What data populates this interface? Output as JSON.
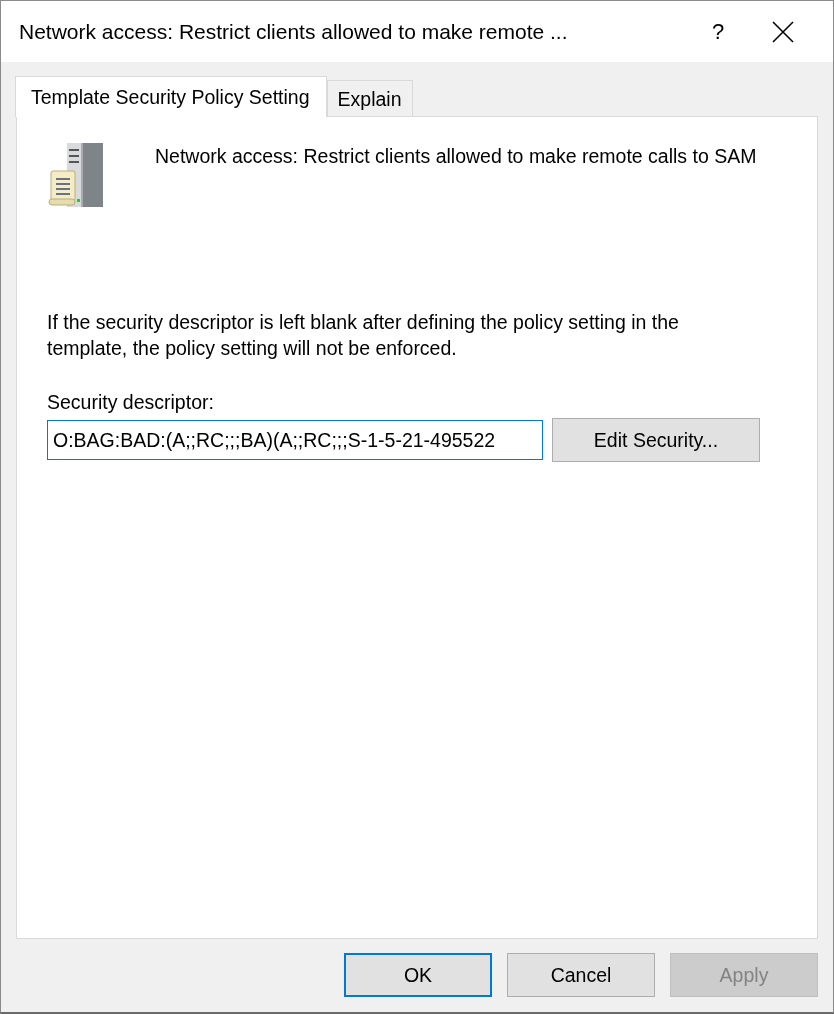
{
  "window": {
    "title": "Network access: Restrict clients allowed to make remote ...",
    "help": "?"
  },
  "tabs": [
    {
      "label": "Template Security Policy Setting",
      "selected": true
    },
    {
      "label": "Explain",
      "selected": false
    }
  ],
  "policy": {
    "name": "Network access: Restrict clients allowed to make remote calls to SAM",
    "note": "If the security descriptor is left blank after defining the policy setting in the template, the policy setting will not be enforced.",
    "descriptor_label": "Security descriptor:",
    "descriptor_value": "O:BAG:BAD:(A;;RC;;;BA)(A;;RC;;;S-1-5-21-495522",
    "edit_button": "Edit Security..."
  },
  "buttons": [
    {
      "label": "OK",
      "focused": true,
      "disabled": false
    },
    {
      "label": "Cancel",
      "focused": false,
      "disabled": false
    },
    {
      "label": "Apply",
      "focused": false,
      "disabled": true
    }
  ]
}
